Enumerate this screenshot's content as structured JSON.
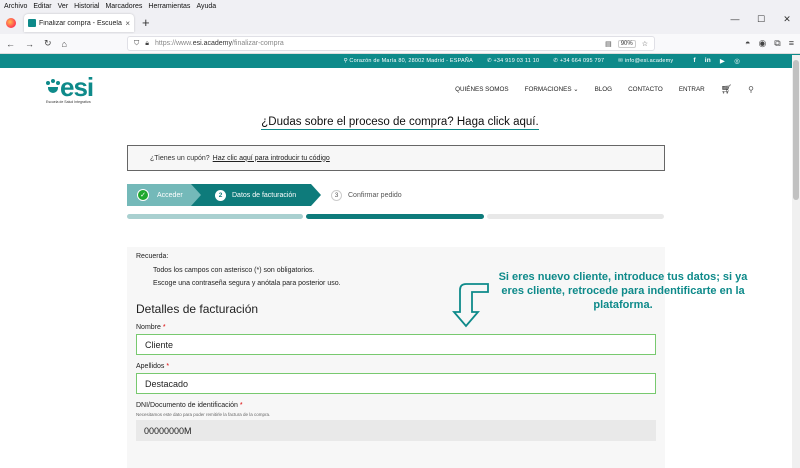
{
  "browser": {
    "menu": [
      "Archivo",
      "Editar",
      "Ver",
      "Historial",
      "Marcadores",
      "Herramientas",
      "Ayuda"
    ],
    "tab_title": "Finalizar compra - Escuela Salud",
    "tab_close": "×",
    "new_tab": "+",
    "url_prefix": "https://www.",
    "url_host": "esi.academy",
    "url_path": "/finalizar-compra",
    "zoom": "90%",
    "window_controls": [
      "—",
      "☐",
      "✕"
    ]
  },
  "topbar": {
    "address": "Corazón de María 80, 28002 Madrid - ESPAÑA",
    "phone1": "+34 919 03 11 10",
    "phone2": "+34 664 095 797",
    "email": "info@esi.academy",
    "social": [
      "f",
      "in",
      "▶",
      "◎"
    ]
  },
  "header": {
    "logo_text": "esi",
    "logo_subtitle": "Escuela de Salud Integrativa",
    "nav": [
      "QUIÉNES SOMOS",
      "FORMACIONES",
      "BLOG",
      "CONTACTO",
      "ENTRAR"
    ],
    "nav_dropdown_arrow": "⌄"
  },
  "help_link": "¿Dudas sobre el proceso de compra? Haga click aquí.",
  "coupon": {
    "text": "¿Tienes un cupón?",
    "link": "Haz clic aquí para introducir tu código"
  },
  "steps": [
    {
      "label": "Acceder",
      "marker": "✓"
    },
    {
      "label": "Datos de facturación",
      "marker": "2"
    },
    {
      "label": "Confirmar pedido",
      "marker": "3"
    }
  ],
  "form": {
    "note_title": "Recuerda:",
    "note_items": [
      "Todos los campos con asterisco (*) son obligatorios.",
      "Escoge una contraseña segura y anótala para posterior uso."
    ],
    "title": "Detalles de facturación",
    "fields": [
      {
        "label": "Nombre",
        "required": "*",
        "value": "Cliente"
      },
      {
        "label": "Apellidos",
        "required": "*",
        "value": "Destacado"
      },
      {
        "label": "DNI/Documento de identificación",
        "required": "*",
        "help": "Necesitamos este dato para poder remitirle la factura de la compra.",
        "value": "00000000M"
      }
    ]
  },
  "callout": "Si eres nuevo cliente, introduce tus datos; si ya eres cliente, retrocede para indentificarte en la plataforma.",
  "colors": {
    "brand": "#0e8a8a",
    "success": "#1ea82e",
    "valid_border": "#78c96f"
  }
}
